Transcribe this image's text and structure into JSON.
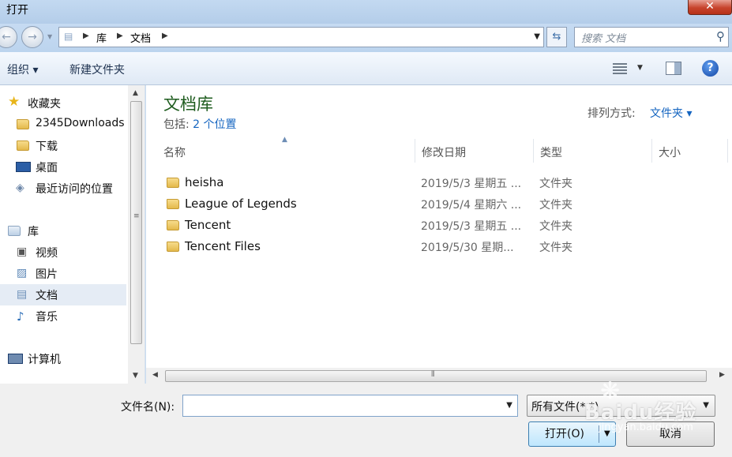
{
  "window": {
    "title": "打开",
    "close_glyph": "✕"
  },
  "nav": {
    "back_glyph": "←",
    "forward_glyph": "→",
    "address_crumbs": [
      "库",
      "文档"
    ],
    "search_placeholder": "搜索 文档",
    "refresh_glyph": "⇆"
  },
  "toolbar": {
    "organize_label": "组织 ▾",
    "new_folder_label": "新建文件夹",
    "help_glyph": "?"
  },
  "sidebar": {
    "items": [
      {
        "label": "收藏夹",
        "icon": "star-icon"
      },
      {
        "label": "2345Downloads",
        "icon": "folder-icon"
      },
      {
        "label": "下载",
        "icon": "download-folder-icon"
      },
      {
        "label": "桌面",
        "icon": "desktop-icon"
      },
      {
        "label": "最近访问的位置",
        "icon": "recent-places-icon"
      },
      {
        "label": "库",
        "icon": "library-icon"
      },
      {
        "label": "视频",
        "icon": "video-library-icon"
      },
      {
        "label": "图片",
        "icon": "pictures-library-icon"
      },
      {
        "label": "文档",
        "icon": "documents-library-icon",
        "selected": true
      },
      {
        "label": "音乐",
        "icon": "music-library-icon"
      },
      {
        "label": "计算机",
        "icon": "computer-icon"
      }
    ]
  },
  "library": {
    "title": "文档库",
    "includes_prefix": "包括: ",
    "includes_link": "2 个位置",
    "arrange_label": "排列方式:",
    "arrange_value": "文件夹 ▾"
  },
  "columns": {
    "name": "名称",
    "date": "修改日期",
    "type": "类型",
    "size": "大小"
  },
  "files": [
    {
      "name": "heisha",
      "date": "2019/5/3 星期五 ...",
      "type": "文件夹"
    },
    {
      "name": "League of Legends",
      "date": "2019/5/4 星期六 ...",
      "type": "文件夹"
    },
    {
      "name": "Tencent",
      "date": "2019/5/3 星期五 ...",
      "type": "文件夹"
    },
    {
      "name": "Tencent Files",
      "date": "2019/5/30 星期...",
      "type": "文件夹"
    }
  ],
  "footer": {
    "filename_label": "文件名(N):",
    "filename_value": "",
    "filetype_value": "所有文件(*.*)",
    "open_label": "打开(O)",
    "cancel_label": "取消"
  },
  "watermark": {
    "brand": "Baidu经验",
    "sub": "jingyan.baidu.com"
  }
}
